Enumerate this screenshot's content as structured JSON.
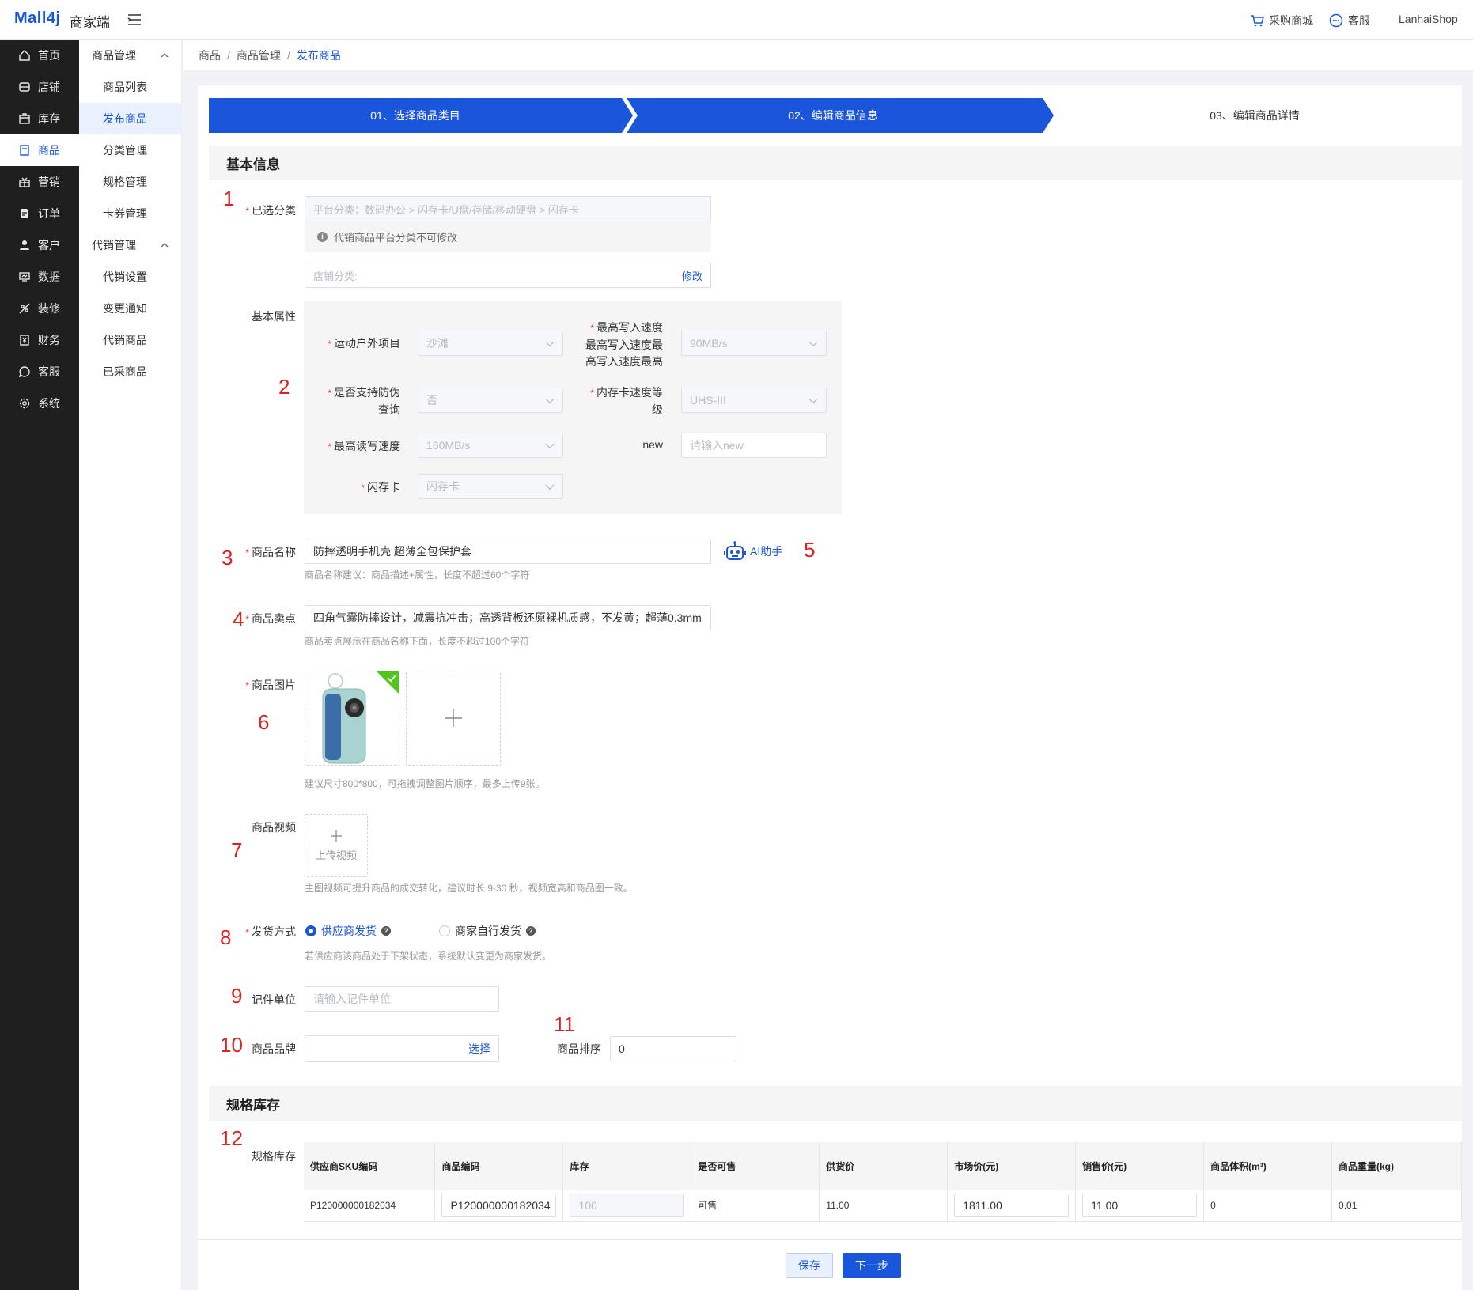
{
  "app": {
    "logo": "Mall4j",
    "logo_sub": "商家端"
  },
  "top_links": {
    "purchase": "采购商城",
    "service": "客服",
    "user": "LanhaiShop"
  },
  "nav": [
    {
      "label": "首页",
      "icon": "home-icon"
    },
    {
      "label": "店铺",
      "icon": "store-icon"
    },
    {
      "label": "库存",
      "icon": "inventory-icon"
    },
    {
      "label": "商品",
      "icon": "product-icon"
    },
    {
      "label": "营销",
      "icon": "gift-icon"
    },
    {
      "label": "订单",
      "icon": "order-icon"
    },
    {
      "label": "客户",
      "icon": "user-icon"
    },
    {
      "label": "数据",
      "icon": "data-icon"
    },
    {
      "label": "装修",
      "icon": "decorate-icon"
    },
    {
      "label": "财务",
      "icon": "finance-icon"
    },
    {
      "label": "客服",
      "icon": "chat-icon"
    },
    {
      "label": "系统",
      "icon": "gear-icon"
    }
  ],
  "subnav": {
    "group1": "商品管理",
    "group1_items": [
      "商品列表",
      "发布商品",
      "分类管理",
      "规格管理",
      "卡券管理"
    ],
    "group2": "代销管理",
    "group2_items": [
      "代销设置",
      "变更通知",
      "代销商品",
      "已采商品"
    ]
  },
  "breadcrumb": [
    "商品",
    "商品管理",
    "发布商品"
  ],
  "steps": [
    "01、选择商品类目",
    "02、编辑商品信息",
    "03、编辑商品详情"
  ],
  "sections": {
    "basic": "基本信息",
    "spec": "规格库存"
  },
  "category": {
    "label": "已选分类",
    "platform": "平台分类：数码办公 > 闪存卡/U盘/存储/移动硬盘 > 闪存卡",
    "notice": "代销商品平台分类不可修改",
    "shop_placeholder": "店铺分类:",
    "modify": "修改"
  },
  "attrs": {
    "label": "基本属性",
    "items": [
      {
        "label": "运动户外项目",
        "value": "沙滩"
      },
      {
        "label_lines": [
          "最高写入速度",
          "最高写入速度最",
          "高写入速度最高"
        ],
        "value": "90MB/s"
      },
      {
        "label_lines": [
          "是否支持防伪",
          "查询"
        ],
        "value": "否"
      },
      {
        "label_lines": [
          "内存卡速度等",
          "级"
        ],
        "value": "UHS-III"
      },
      {
        "label": "最高读写速度",
        "value": "160MB/s"
      },
      {
        "label": "new",
        "placeholder": "请输入new"
      },
      {
        "label": "闪存卡",
        "value": "闪存卡"
      }
    ]
  },
  "product_name": {
    "label": "商品名称",
    "value": "防摔透明手机壳 超薄全包保护套",
    "hint": "商品名称建议：商品描述+属性，长度不超过60个字符",
    "ai": "AI助手"
  },
  "selling_point": {
    "label": "商品卖点",
    "value": "四角气囊防摔设计，减震抗冲击；高透背板还原裸机质感，不发黄；超薄0.3mm",
    "hint": "商品卖点展示在商品名称下面，长度不超过100个字符"
  },
  "images": {
    "label": "商品图片",
    "hint": "建议尺寸800*800，可拖拽调整图片顺序，最多上传9张。"
  },
  "video": {
    "label": "商品视频",
    "upload": "上传视频",
    "hint": "主图视频可提升商品的成交转化，建议时长 9-30 秒，视频宽高和商品图一致。"
  },
  "shipping": {
    "label": "发货方式",
    "opt1": "供应商发货",
    "opt2": "商家自行发货",
    "hint": "若供应商该商品处于下架状态，系统默认变更为商家发货。"
  },
  "unit": {
    "label": "记件单位",
    "placeholder": "请输入记件单位"
  },
  "brand": {
    "label": "商品品牌",
    "select": "选择"
  },
  "sort": {
    "label": "商品排序",
    "value": "0"
  },
  "spec_label": "规格库存",
  "table": {
    "headers": [
      "供应商SKU编码",
      "商品编码",
      "库存",
      "是否可售",
      "供货价",
      "市场价(元)",
      "销售价(元)",
      "商品体积(m³)",
      "商品重量(kg)"
    ],
    "row": {
      "sku": "P120000000182034",
      "code": "P120000000182034",
      "stock": "100",
      "sale": "可售",
      "supply": "11.00",
      "market": "1811.00",
      "price": "11.00",
      "volume": "0",
      "weight": "0.01"
    }
  },
  "buttons": {
    "save": "保存",
    "next": "下一步"
  },
  "annotations": [
    "1",
    "2",
    "3",
    "4",
    "5",
    "6",
    "7",
    "8",
    "9",
    "10",
    "11",
    "12"
  ],
  "colors": {
    "primary": "#1a56db",
    "annotation": "#e02020",
    "sidebar": "#1f1f1f"
  }
}
